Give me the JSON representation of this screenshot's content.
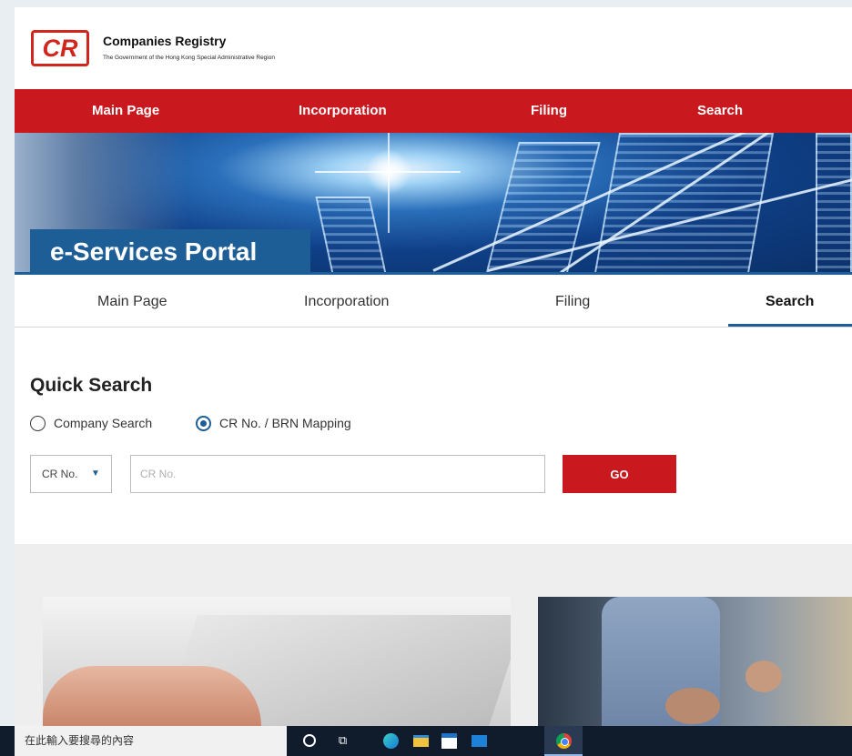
{
  "header": {
    "logo_text": "CR",
    "org_name": "Companies Registry",
    "org_subtitle": "The Government of the Hong Kong Special Administrative Region"
  },
  "top_nav": {
    "items": [
      {
        "label": "Main Page"
      },
      {
        "label": "Incorporation"
      },
      {
        "label": "Filing"
      },
      {
        "label": "Search"
      }
    ]
  },
  "banner": {
    "title": "e-Services Portal"
  },
  "sub_nav": {
    "items": [
      {
        "label": "Main Page",
        "active": false
      },
      {
        "label": "Incorporation",
        "active": false
      },
      {
        "label": "Filing",
        "active": false
      },
      {
        "label": "Search",
        "active": true
      }
    ]
  },
  "quick_search": {
    "title": "Quick Search",
    "options": [
      {
        "label": "Company Search",
        "selected": false
      },
      {
        "label": "CR No. / BRN Mapping",
        "selected": true
      }
    ],
    "search_type": {
      "selected": "CR No."
    },
    "input": {
      "value": "",
      "placeholder": "CR No."
    },
    "go_label": "GO"
  },
  "taskbar": {
    "search_placeholder": "在此輸入要搜尋的內容",
    "icons": [
      "cortana-icon",
      "task-view-icon",
      "edge-icon",
      "file-explorer-icon",
      "store-icon",
      "mail-icon",
      "chrome-icon"
    ]
  },
  "colors": {
    "brand_red": "#c9191f",
    "brand_blue": "#1d5e96"
  }
}
